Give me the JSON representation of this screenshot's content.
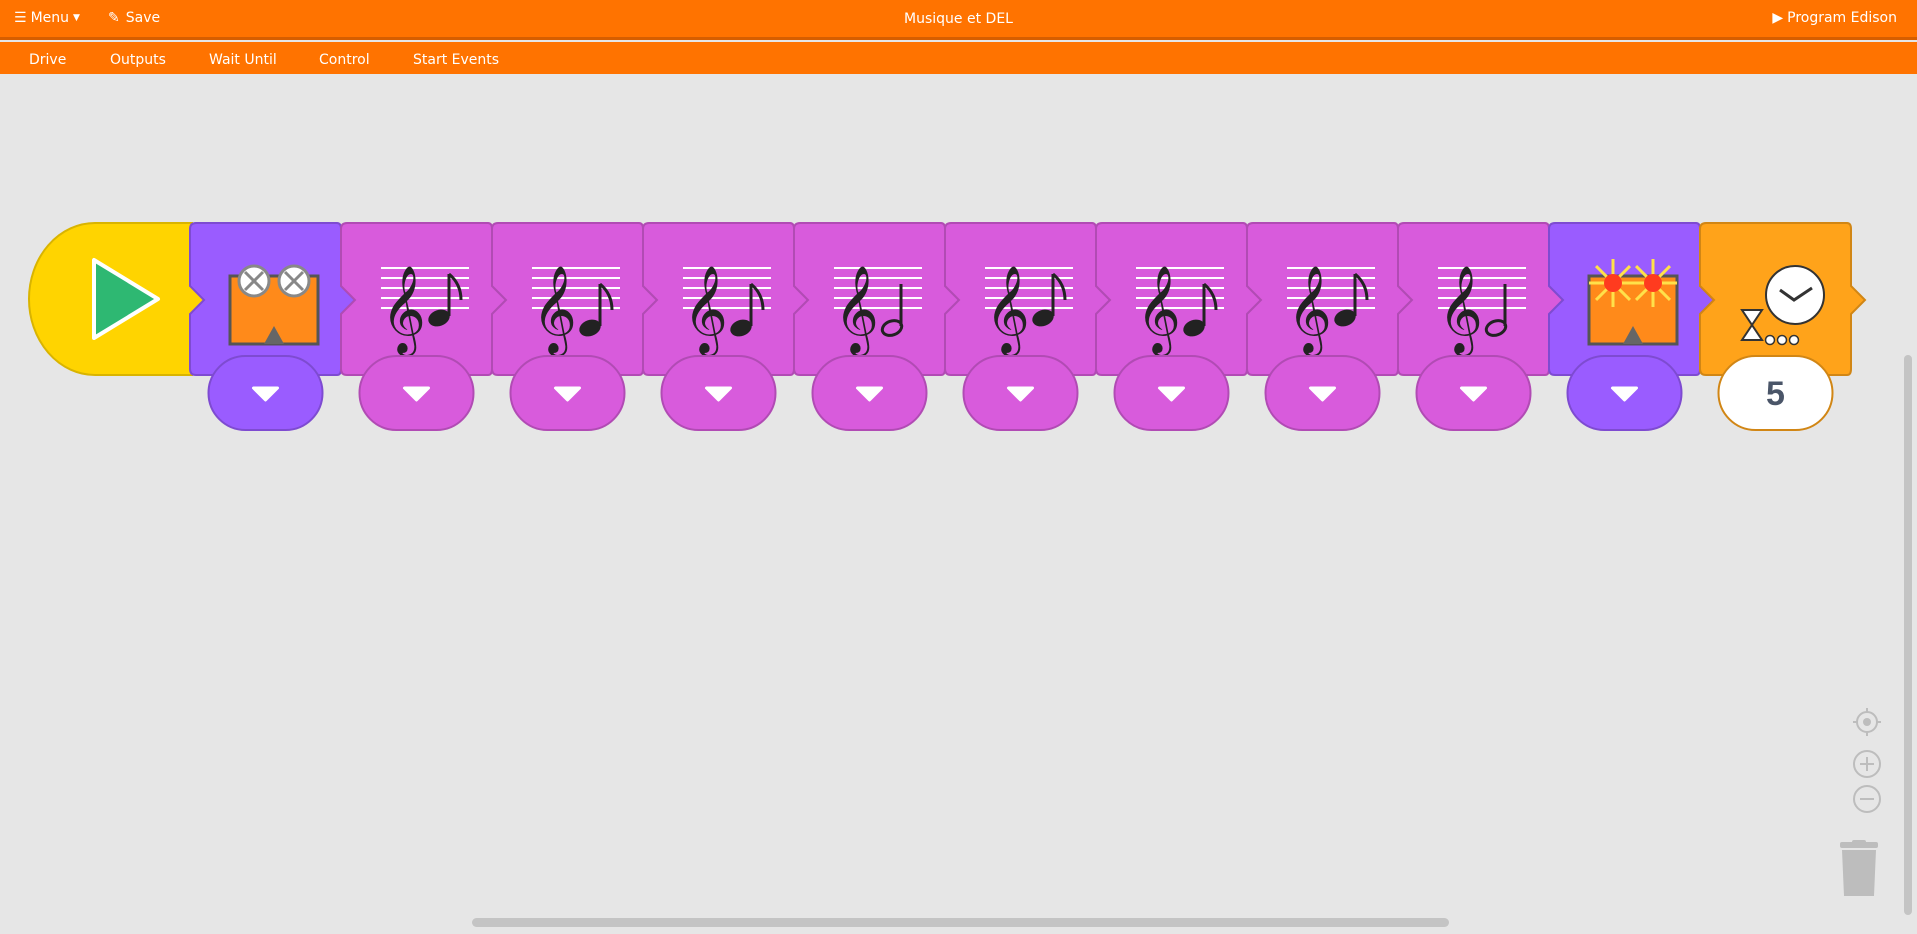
{
  "app": {
    "menu_label": "Menu",
    "save_label": "Save",
    "title": "Musique et DEL",
    "program_label": "Program Edison"
  },
  "categories": [
    "Drive",
    "Outputs",
    "Wait Until",
    "Control",
    "Start Events"
  ],
  "blocks": [
    {
      "kind": "start",
      "color": "#ffd400"
    },
    {
      "kind": "led-off",
      "color": "#9a5cff"
    },
    {
      "kind": "note",
      "note": "eighth",
      "pitch": "mid",
      "color": "#d85bdc"
    },
    {
      "kind": "note",
      "note": "eighth",
      "pitch": "low",
      "color": "#d85bdc"
    },
    {
      "kind": "note",
      "note": "eighth",
      "pitch": "low",
      "color": "#d85bdc"
    },
    {
      "kind": "note",
      "note": "half",
      "pitch": "low",
      "color": "#d85bdc"
    },
    {
      "kind": "note",
      "note": "eighth",
      "pitch": "mid",
      "color": "#d85bdc"
    },
    {
      "kind": "note",
      "note": "eighth",
      "pitch": "low",
      "color": "#d85bdc"
    },
    {
      "kind": "note",
      "note": "eighth",
      "pitch": "mid",
      "color": "#d85bdc"
    },
    {
      "kind": "note",
      "note": "half",
      "pitch": "low",
      "color": "#d85bdc"
    },
    {
      "kind": "led-on",
      "color": "#9a5cff"
    },
    {
      "kind": "wait",
      "color": "#ffa31a",
      "value": "5"
    }
  ],
  "colors": {
    "header": "#ff7300",
    "canvas": "#e6e6e6",
    "start": "#ffd400",
    "play": "#2eb872",
    "led": "#9a5cff",
    "music": "#d85bdc",
    "wait": "#ffa31a"
  },
  "icons": [
    "hamburger-icon",
    "pencil-icon",
    "play-icon",
    "recenter-icon",
    "zoom-in-icon",
    "zoom-out-icon",
    "trash-icon"
  ]
}
